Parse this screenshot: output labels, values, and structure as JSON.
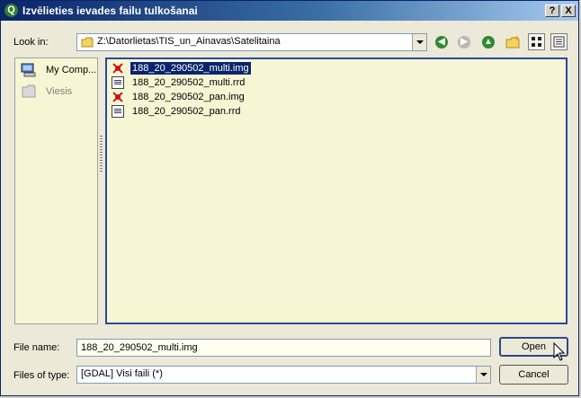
{
  "window": {
    "title": "Izvēlieties ievades failu tulkošanai",
    "help_label": "?",
    "close_label": "X",
    "app_icon_letter": "Q"
  },
  "lookin": {
    "label": "Look in:",
    "path": "Z:\\Datorlietas\\TIS_un_Ainavas\\Satelitaina"
  },
  "sidebar": {
    "items": [
      {
        "label": "My Comp...",
        "icon": "computer-icon"
      },
      {
        "label": "Viesis",
        "icon": "folder-icon"
      }
    ]
  },
  "files": [
    {
      "name": "188_20_290502_multi.img",
      "icon": "raster-icon",
      "selected": true
    },
    {
      "name": "188_20_290502_multi.rrd",
      "icon": "document-icon",
      "selected": false
    },
    {
      "name": "188_20_290502_pan.img",
      "icon": "raster-icon",
      "selected": false
    },
    {
      "name": "188_20_290502_pan.rrd",
      "icon": "document-icon",
      "selected": false
    }
  ],
  "filename": {
    "label": "File name:",
    "value": "188_20_290502_multi.img"
  },
  "filetype": {
    "label": "Files of type:",
    "value": "[GDAL] Visi faili (*)"
  },
  "buttons": {
    "open": "Open",
    "cancel": "Cancel"
  },
  "colors": {
    "title_start": "#0a246a",
    "title_end": "#a6caf0",
    "panel_bg": "#f6f6d4",
    "selection": "#0a246a"
  }
}
